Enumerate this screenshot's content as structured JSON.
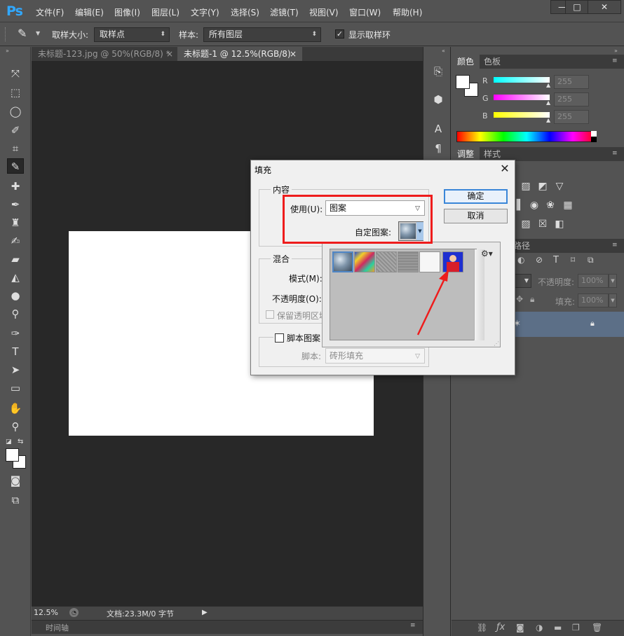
{
  "app": {
    "logo": "Ps",
    "menu": [
      "文件(F)",
      "编辑(E)",
      "图像(I)",
      "图层(L)",
      "文字(Y)",
      "选择(S)",
      "滤镜(T)",
      "视图(V)",
      "窗口(W)",
      "帮助(H)"
    ],
    "window_buttons": [
      "—",
      "□",
      "✕"
    ]
  },
  "options": {
    "sample_size_label": "取样大小:",
    "sample_size_value": "取样点",
    "sample_label": "样本:",
    "sample_value": "所有图层",
    "show_ring_label": "显示取样环",
    "show_ring_checked": "✓"
  },
  "tabs": [
    {
      "label": "未标题-123.jpg @ 50%(RGB/8) *",
      "close": "×"
    },
    {
      "label": "未标题-1 @ 12.5%(RGB/8)",
      "close": "×"
    }
  ],
  "status": {
    "zoom": "12.5%",
    "doc_info": "文档:23.3M/0 字节",
    "timeline_label": "时间轴"
  },
  "color_panel": {
    "tabs": [
      "颜色",
      "色板"
    ],
    "channels": [
      {
        "label": "R",
        "value": "255"
      },
      {
        "label": "G",
        "value": "255"
      },
      {
        "label": "B",
        "value": "255"
      }
    ]
  },
  "adjust_panel": {
    "tabs": [
      "调整",
      "样式"
    ]
  },
  "layers_panel": {
    "tab_partial": "路径",
    "opacity_label": "不透明度:",
    "opacity_value": "100%",
    "fill_label": "填充:",
    "fill_value": "100%"
  },
  "dialog": {
    "title": "填充",
    "close": "✕",
    "content_group": "内容",
    "use_label": "使用(U):",
    "use_value": "图案",
    "custom_pattern_label": "自定图案:",
    "ok": "确定",
    "cancel": "取消",
    "blend_group": "混合",
    "mode_label": "模式(M):",
    "opacity_label": "不透明度(O):",
    "preserve_label": "保留透明区域",
    "script_label": "脚本图案",
    "script_sub_label": "脚本:",
    "script_value": "砖形填充"
  },
  "colors": {
    "accent_blue": "#3a86d8",
    "annotation_red": "#ee1c1c",
    "ps_blue": "#31a8ff"
  }
}
